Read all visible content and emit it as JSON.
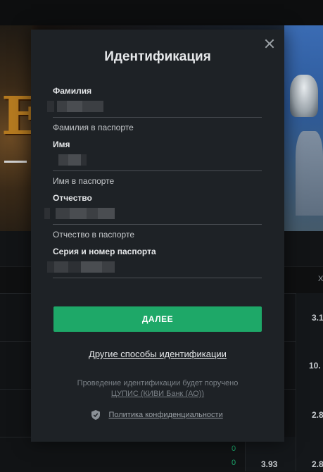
{
  "background": {
    "banner_letter": "E",
    "column_header": "X",
    "rows": [
      {
        "odd": "3.1"
      },
      {
        "odd": "10."
      },
      {
        "odd": "2.8"
      },
      {
        "odd": "2.8",
        "odd_mid": "3.93",
        "small_values": [
          "0",
          "0"
        ]
      }
    ]
  },
  "modal": {
    "title": "Идентификация",
    "fields": [
      {
        "label": "Фамилия",
        "hint": "Фамилия в паспорте"
      },
      {
        "label": "Имя",
        "hint": "Имя в паспорте"
      },
      {
        "label": "Отчество",
        "hint": "Отчество в паспорте"
      },
      {
        "label": "Серия и номер паспорта",
        "hint": ""
      }
    ],
    "next_button": "ДАЛЕЕ",
    "other_methods_link": "Другие способы идентификации",
    "info_line1": "Проведение идентификации будет поручено",
    "info_link": "ЦУПИС (КИВИ Банк (АО))",
    "privacy_link": "Политика конфиденциальности"
  },
  "colors": {
    "accent": "#1ea868",
    "modal_bg": "#1e2226",
    "page_bg": "#0b0c0d"
  }
}
